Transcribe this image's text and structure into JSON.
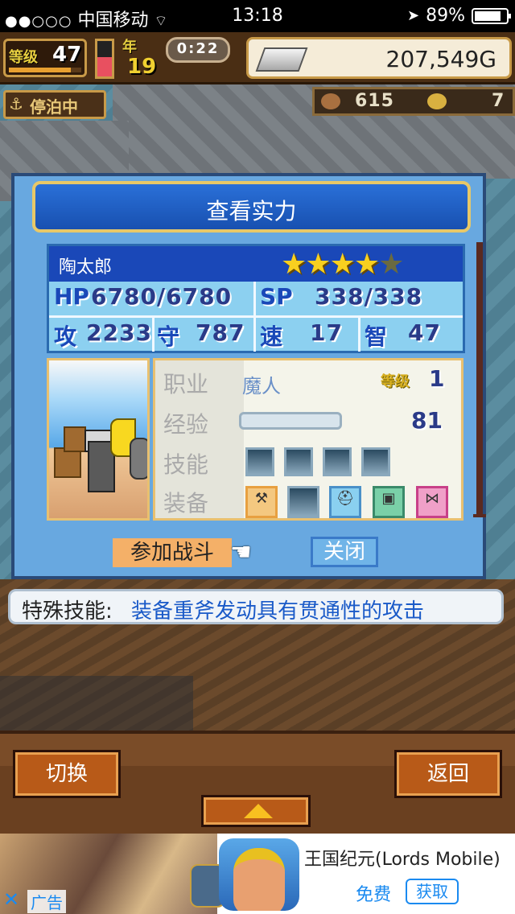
{
  "status_bar": {
    "signal": "●●○○○",
    "carrier": "中国移动",
    "time": "13:18",
    "battery_percent": "89%",
    "battery_level": 0.89
  },
  "hud": {
    "level_label": "等级",
    "level": "47",
    "level_progress": 0.85,
    "meter_level": 0.55,
    "year_label": "年",
    "year": "19",
    "timer": "0:22",
    "money": "207,549G",
    "docked_label": "停泊中",
    "fish_count": "615",
    "coin_count": "7"
  },
  "dialog": {
    "title": "查看实力",
    "character": {
      "name": "陶太郎",
      "stars_filled": "★★★★",
      "stars_empty": "★",
      "hp_label": "HP",
      "hp": "6780/6780",
      "sp_label": "SP",
      "sp": "338/338",
      "atk_label": "攻",
      "atk": "2233",
      "def_label": "守",
      "def": "787",
      "spd_label": "速",
      "spd": "17",
      "int_label": "智",
      "int": "47"
    },
    "info": {
      "job_label": "职业",
      "job": "魔人",
      "level_tag": "等级",
      "level": "1",
      "exp_label": "经验",
      "exp_progress": 0.0,
      "exp": "81",
      "skill_label": "技能",
      "equip_label": "装备"
    },
    "join_button": "参加战斗",
    "close_button": "关闭"
  },
  "special_skill": {
    "label": "特殊技能:",
    "value": "装备重斧发动具有贯通性的攻击"
  },
  "bottom": {
    "switch_button": "切换",
    "back_button": "返回"
  },
  "ad": {
    "title": "王国纪元(Lords Mobile)",
    "price": "免费",
    "get_button": "获取",
    "close": "✕",
    "tag": "广告"
  }
}
